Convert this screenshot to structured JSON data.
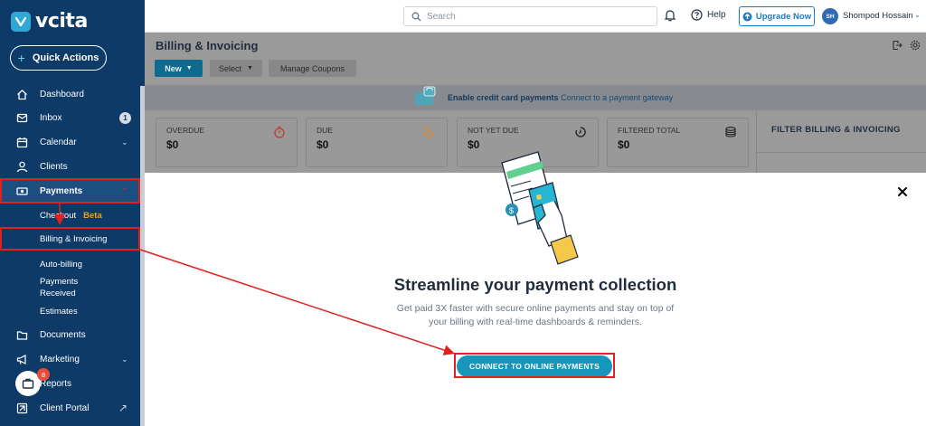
{
  "app": {
    "logo_text": "vcita"
  },
  "sidebar": {
    "quick_actions": "Quick Actions",
    "items": [
      {
        "label": "Dashboard",
        "icon": "home-icon"
      },
      {
        "label": "Inbox",
        "icon": "inbox-icon",
        "badge": "1"
      },
      {
        "label": "Calendar",
        "icon": "calendar-icon"
      },
      {
        "label": "Clients",
        "icon": "user-icon"
      },
      {
        "label": "Payments",
        "icon": "payments-icon"
      },
      {
        "label": "Documents",
        "icon": "folder-icon"
      },
      {
        "label": "Marketing",
        "icon": "megaphone-icon"
      },
      {
        "label": "Reports",
        "icon": "reports-icon"
      },
      {
        "label": "Client Portal",
        "icon": "portal-icon"
      }
    ],
    "payments_sub": {
      "checkout": "Checkout",
      "beta": "Beta",
      "billing": "Billing & Invoicing",
      "autobilling": "Auto-billing",
      "payments_received_1": "Payments",
      "payments_received_2": "Received",
      "estimates": "Estimates"
    },
    "briefcase_badge": "8"
  },
  "topbar": {
    "search_placeholder": "Search",
    "help": "Help",
    "upgrade": "Upgrade Now",
    "avatar_initials": "SH",
    "user_name": "Shompod Hossain"
  },
  "page": {
    "title": "Billing & Invoicing",
    "new_btn": "New",
    "select_btn": "Select",
    "coupons_btn": "Manage Coupons",
    "banner_bold": "Enable credit card payments",
    "banner_link": "Connect to a payment gateway",
    "stats": [
      {
        "label": "OVERDUE",
        "value": "$0",
        "icon": "stopwatch-icon"
      },
      {
        "label": "DUE",
        "value": "$0",
        "icon": "clock-icon"
      },
      {
        "label": "NOT YET DUE",
        "value": "$0",
        "icon": "timer-icon"
      },
      {
        "label": "FILTERED TOTAL",
        "value": "$0",
        "icon": "coins-icon"
      }
    ],
    "filter_title": "FILTER BILLING & INVOICING"
  },
  "modal": {
    "title": "Streamline your payment collection",
    "desc_line1": "Get paid 3X faster with secure online payments and stay on top of",
    "desc_line2": "your billing with real-time dashboards & reminders.",
    "cta": "CONNECT TO ONLINE PAYMENTS"
  },
  "colors": {
    "sidebar": "#0d3a66",
    "accent": "#1795bb",
    "annotation": "#e32020",
    "beta": "#f2992e"
  }
}
